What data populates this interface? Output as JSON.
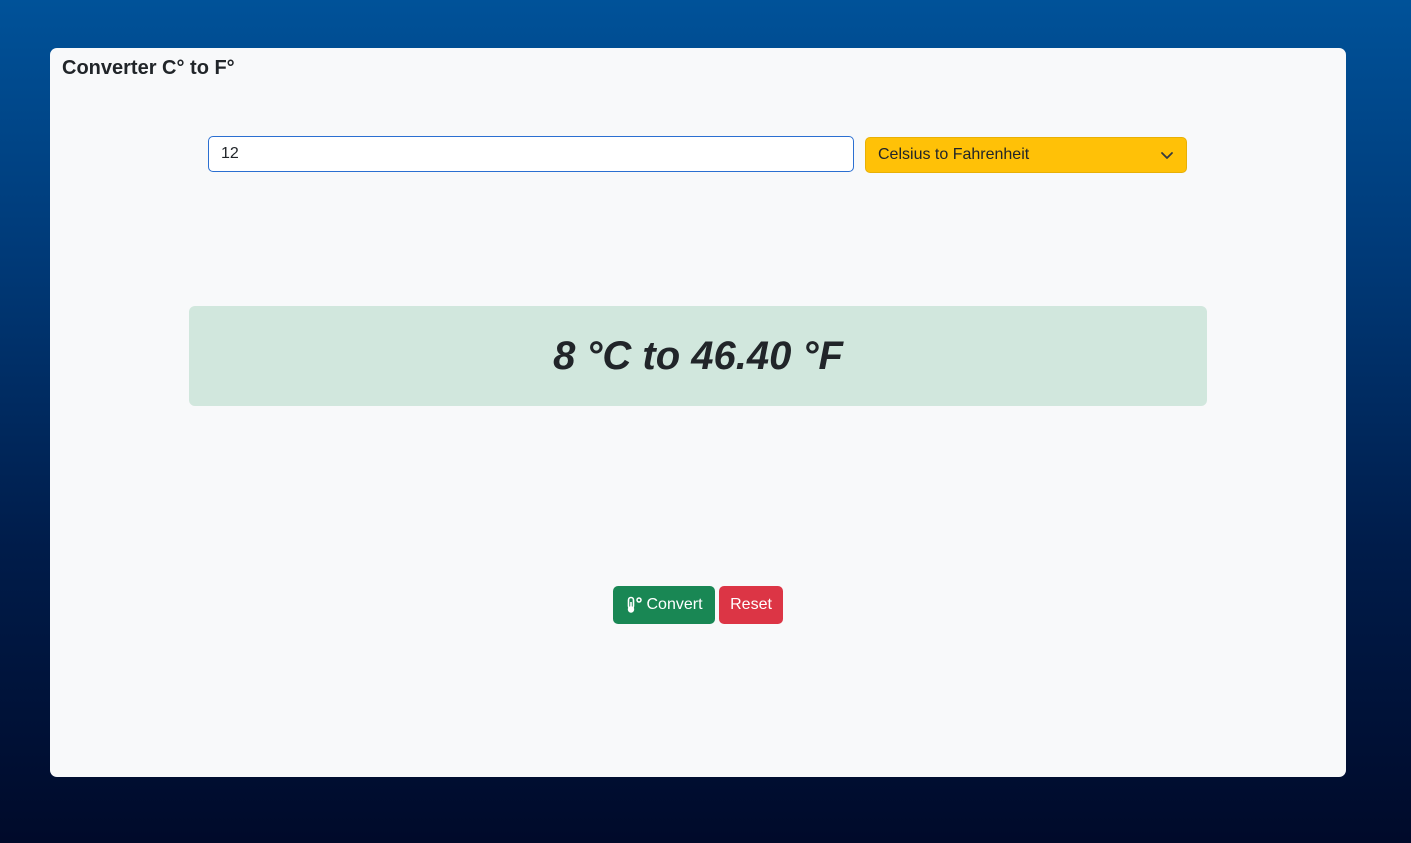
{
  "card": {
    "title": "Converter C° to F°"
  },
  "form": {
    "temperature_value": "12",
    "conversion_select": {
      "selected": "Celsius to Fahrenheit",
      "icon": "chevron-down-icon"
    }
  },
  "result": {
    "text": "8 °C to 46.40 °F"
  },
  "buttons": {
    "convert_label": "Convert",
    "convert_icon": "thermometer-icon",
    "reset_label": "Reset"
  },
  "colors": {
    "select_bg": "#ffc107",
    "result_bg": "#d1e7dd",
    "convert_bg": "#198754",
    "reset_bg": "#dc3545"
  }
}
